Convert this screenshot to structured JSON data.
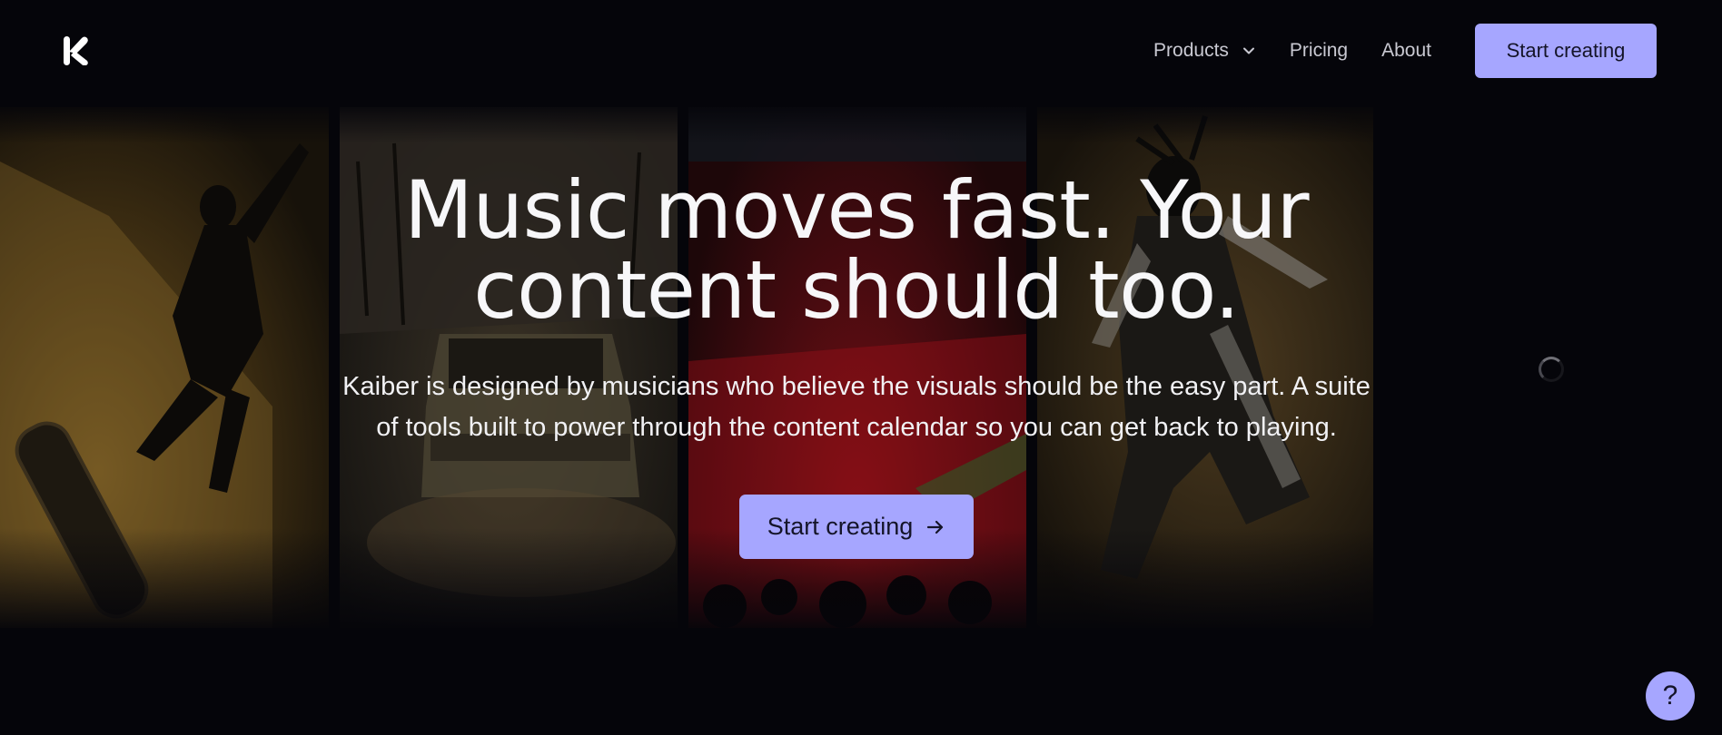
{
  "nav": {
    "links": [
      {
        "label": "Products",
        "has_dropdown": true
      },
      {
        "label": "Pricing"
      },
      {
        "label": "About"
      }
    ],
    "cta_label": "Start creating"
  },
  "hero": {
    "title_line1": "Music moves fast. Your",
    "title_line2": "content should too.",
    "subtitle_line1": "Kaiber is designed by musicians who believe the visuals should be the easy part. A suite",
    "subtitle_line2": "of tools built to power through the content calendar so you can get back to playing.",
    "cta_label": "Start creating"
  },
  "help_button": {
    "label": "?"
  },
  "colors": {
    "background": "#05050a",
    "accent": "#a6a6ff",
    "accent_text": "#141428",
    "nav_text": "#c9c9d2"
  },
  "icons": [
    "kaiber-logo-icon",
    "chevron-down-icon",
    "arrow-right-icon",
    "loading-spinner-icon",
    "help-icon"
  ]
}
